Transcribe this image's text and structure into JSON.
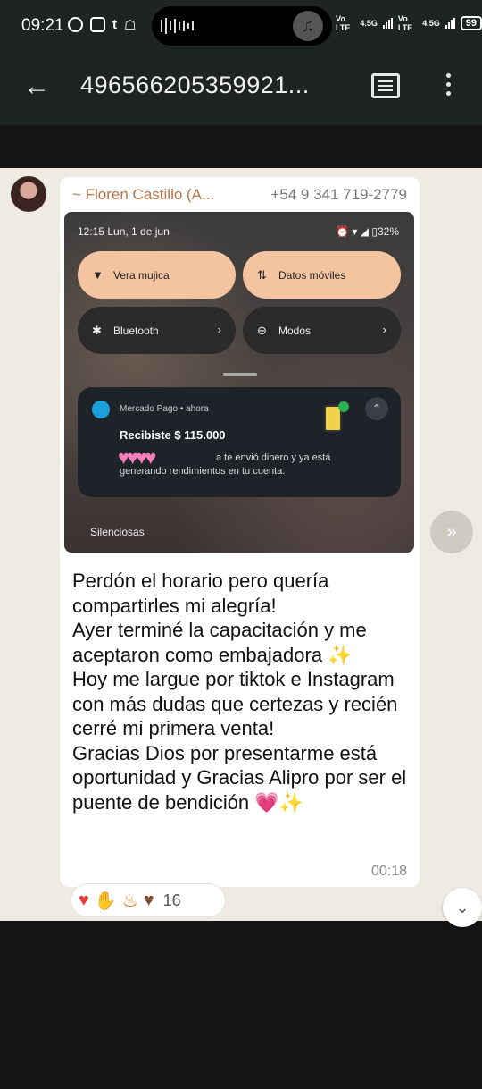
{
  "status_bar": {
    "time": "09:21",
    "battery": "99",
    "network_labels": [
      "Vo LTE",
      "4.5G",
      "Vo LTE",
      "4.5G"
    ]
  },
  "app_bar": {
    "title": "496566205359921..."
  },
  "message": {
    "sender": "~ Floren Castillo (A...",
    "phone": "+54 9 341 719-2779",
    "time": "00:18",
    "lines": [
      "Perdón el horario pero quería compartirles mi alegría!",
      "Ayer terminé la capacitación y me aceptaron como embajadora ✨",
      "Hoy me largue por tiktok e Instagram con más dudas que certezas y recién cerré mi primera venta!",
      "Gracias Dios por presentarme está oportunidad y Gracias Alipro por ser el puente de bendición 💗✨"
    ]
  },
  "screenshot": {
    "time": "12:15  Lun, 1 de jun",
    "status": "32%",
    "tiles": [
      {
        "label": "Vera mujica",
        "state": "on"
      },
      {
        "label": "Datos móviles",
        "state": "on"
      },
      {
        "label": "Bluetooth",
        "state": "off"
      },
      {
        "label": "Modos",
        "state": "off"
      }
    ],
    "notification": {
      "app": "Mercado Pago • ahora",
      "title": "Recibiste $ 115.000",
      "line1": "a te envió dinero y ya está",
      "line2": "generando rendimientos en tu cuenta."
    },
    "footer": "Silenciosas"
  },
  "reactions": {
    "count": "16",
    "emojis": [
      "red-heart",
      "clapping-hands",
      "fire",
      "brown-heart"
    ]
  },
  "colors": {
    "header_bg": "#1e2422",
    "chat_bg": "#efeae2",
    "sender_color": "#b6744a"
  }
}
